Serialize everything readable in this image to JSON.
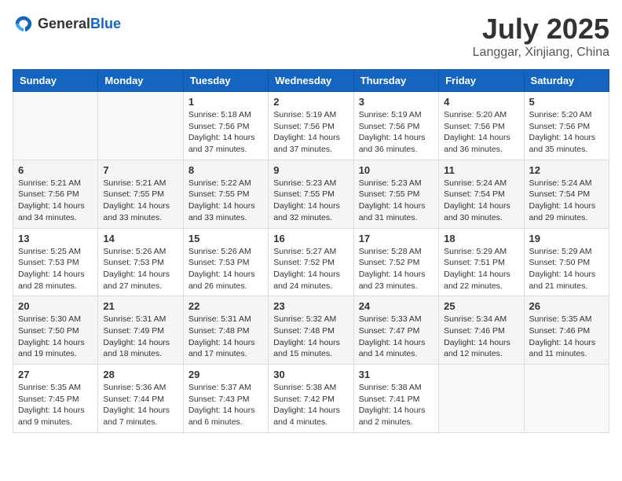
{
  "header": {
    "logo_general": "General",
    "logo_blue": "Blue",
    "month_title": "July 2025",
    "location": "Langgar, Xinjiang, China"
  },
  "days_of_week": [
    "Sunday",
    "Monday",
    "Tuesday",
    "Wednesday",
    "Thursday",
    "Friday",
    "Saturday"
  ],
  "weeks": [
    [
      {
        "day": "",
        "info": ""
      },
      {
        "day": "",
        "info": ""
      },
      {
        "day": "1",
        "sunrise": "Sunrise: 5:18 AM",
        "sunset": "Sunset: 7:56 PM",
        "daylight": "Daylight: 14 hours and 37 minutes."
      },
      {
        "day": "2",
        "sunrise": "Sunrise: 5:19 AM",
        "sunset": "Sunset: 7:56 PM",
        "daylight": "Daylight: 14 hours and 37 minutes."
      },
      {
        "day": "3",
        "sunrise": "Sunrise: 5:19 AM",
        "sunset": "Sunset: 7:56 PM",
        "daylight": "Daylight: 14 hours and 36 minutes."
      },
      {
        "day": "4",
        "sunrise": "Sunrise: 5:20 AM",
        "sunset": "Sunset: 7:56 PM",
        "daylight": "Daylight: 14 hours and 36 minutes."
      },
      {
        "day": "5",
        "sunrise": "Sunrise: 5:20 AM",
        "sunset": "Sunset: 7:56 PM",
        "daylight": "Daylight: 14 hours and 35 minutes."
      }
    ],
    [
      {
        "day": "6",
        "sunrise": "Sunrise: 5:21 AM",
        "sunset": "Sunset: 7:56 PM",
        "daylight": "Daylight: 14 hours and 34 minutes."
      },
      {
        "day": "7",
        "sunrise": "Sunrise: 5:21 AM",
        "sunset": "Sunset: 7:55 PM",
        "daylight": "Daylight: 14 hours and 33 minutes."
      },
      {
        "day": "8",
        "sunrise": "Sunrise: 5:22 AM",
        "sunset": "Sunset: 7:55 PM",
        "daylight": "Daylight: 14 hours and 33 minutes."
      },
      {
        "day": "9",
        "sunrise": "Sunrise: 5:23 AM",
        "sunset": "Sunset: 7:55 PM",
        "daylight": "Daylight: 14 hours and 32 minutes."
      },
      {
        "day": "10",
        "sunrise": "Sunrise: 5:23 AM",
        "sunset": "Sunset: 7:55 PM",
        "daylight": "Daylight: 14 hours and 31 minutes."
      },
      {
        "day": "11",
        "sunrise": "Sunrise: 5:24 AM",
        "sunset": "Sunset: 7:54 PM",
        "daylight": "Daylight: 14 hours and 30 minutes."
      },
      {
        "day": "12",
        "sunrise": "Sunrise: 5:24 AM",
        "sunset": "Sunset: 7:54 PM",
        "daylight": "Daylight: 14 hours and 29 minutes."
      }
    ],
    [
      {
        "day": "13",
        "sunrise": "Sunrise: 5:25 AM",
        "sunset": "Sunset: 7:53 PM",
        "daylight": "Daylight: 14 hours and 28 minutes."
      },
      {
        "day": "14",
        "sunrise": "Sunrise: 5:26 AM",
        "sunset": "Sunset: 7:53 PM",
        "daylight": "Daylight: 14 hours and 27 minutes."
      },
      {
        "day": "15",
        "sunrise": "Sunrise: 5:26 AM",
        "sunset": "Sunset: 7:53 PM",
        "daylight": "Daylight: 14 hours and 26 minutes."
      },
      {
        "day": "16",
        "sunrise": "Sunrise: 5:27 AM",
        "sunset": "Sunset: 7:52 PM",
        "daylight": "Daylight: 14 hours and 24 minutes."
      },
      {
        "day": "17",
        "sunrise": "Sunrise: 5:28 AM",
        "sunset": "Sunset: 7:52 PM",
        "daylight": "Daylight: 14 hours and 23 minutes."
      },
      {
        "day": "18",
        "sunrise": "Sunrise: 5:29 AM",
        "sunset": "Sunset: 7:51 PM",
        "daylight": "Daylight: 14 hours and 22 minutes."
      },
      {
        "day": "19",
        "sunrise": "Sunrise: 5:29 AM",
        "sunset": "Sunset: 7:50 PM",
        "daylight": "Daylight: 14 hours and 21 minutes."
      }
    ],
    [
      {
        "day": "20",
        "sunrise": "Sunrise: 5:30 AM",
        "sunset": "Sunset: 7:50 PM",
        "daylight": "Daylight: 14 hours and 19 minutes."
      },
      {
        "day": "21",
        "sunrise": "Sunrise: 5:31 AM",
        "sunset": "Sunset: 7:49 PM",
        "daylight": "Daylight: 14 hours and 18 minutes."
      },
      {
        "day": "22",
        "sunrise": "Sunrise: 5:31 AM",
        "sunset": "Sunset: 7:48 PM",
        "daylight": "Daylight: 14 hours and 17 minutes."
      },
      {
        "day": "23",
        "sunrise": "Sunrise: 5:32 AM",
        "sunset": "Sunset: 7:48 PM",
        "daylight": "Daylight: 14 hours and 15 minutes."
      },
      {
        "day": "24",
        "sunrise": "Sunrise: 5:33 AM",
        "sunset": "Sunset: 7:47 PM",
        "daylight": "Daylight: 14 hours and 14 minutes."
      },
      {
        "day": "25",
        "sunrise": "Sunrise: 5:34 AM",
        "sunset": "Sunset: 7:46 PM",
        "daylight": "Daylight: 14 hours and 12 minutes."
      },
      {
        "day": "26",
        "sunrise": "Sunrise: 5:35 AM",
        "sunset": "Sunset: 7:46 PM",
        "daylight": "Daylight: 14 hours and 11 minutes."
      }
    ],
    [
      {
        "day": "27",
        "sunrise": "Sunrise: 5:35 AM",
        "sunset": "Sunset: 7:45 PM",
        "daylight": "Daylight: 14 hours and 9 minutes."
      },
      {
        "day": "28",
        "sunrise": "Sunrise: 5:36 AM",
        "sunset": "Sunset: 7:44 PM",
        "daylight": "Daylight: 14 hours and 7 minutes."
      },
      {
        "day": "29",
        "sunrise": "Sunrise: 5:37 AM",
        "sunset": "Sunset: 7:43 PM",
        "daylight": "Daylight: 14 hours and 6 minutes."
      },
      {
        "day": "30",
        "sunrise": "Sunrise: 5:38 AM",
        "sunset": "Sunset: 7:42 PM",
        "daylight": "Daylight: 14 hours and 4 minutes."
      },
      {
        "day": "31",
        "sunrise": "Sunrise: 5:38 AM",
        "sunset": "Sunset: 7:41 PM",
        "daylight": "Daylight: 14 hours and 2 minutes."
      },
      {
        "day": "",
        "info": ""
      },
      {
        "day": "",
        "info": ""
      }
    ]
  ]
}
